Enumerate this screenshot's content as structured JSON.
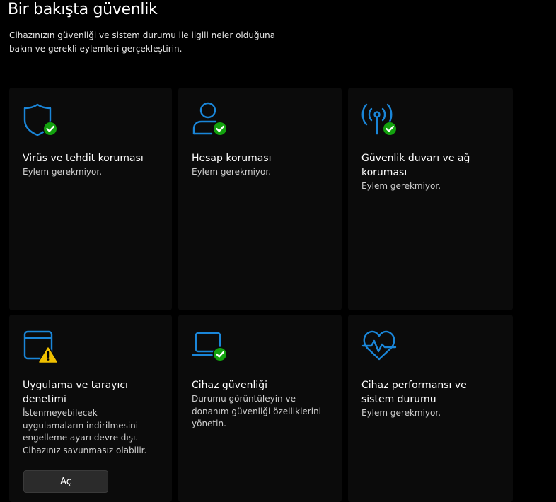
{
  "page": {
    "title": "Bir bakışta güvenlik",
    "description": "Cihazınızın güvenliği ve sistem durumu ile ilgili neler olduğuna bakın ve gerekli eylemleri gerçekleştirin."
  },
  "colors": {
    "accent": "#1a86d9",
    "ok": "#13a10e",
    "warning": "#f0c000",
    "tile_bg": "#0b0b0b",
    "page_bg": "#000000"
  },
  "tiles": [
    {
      "name": "Virüs ve tehdit koruması",
      "status": "Eylem gerekmiyor.",
      "icon": "shield-icon",
      "badge": "ok-check-icon"
    },
    {
      "name": "Hesap koruması",
      "status": "Eylem gerekmiyor.",
      "icon": "person-icon",
      "badge": "ok-check-icon"
    },
    {
      "name": "Güvenlik duvarı ve ağ koruması",
      "status": "Eylem gerekmiyor.",
      "icon": "antenna-icon",
      "badge": "ok-check-icon"
    },
    {
      "name": "Uygulama ve tarayıcı denetimi",
      "status": "İstenmeyebilecek uygulamaların indirilmesini engelleme ayarı devre dışı. Cihazınız savunmasız olabilir.",
      "icon": "browser-window-icon",
      "badge": "warning-icon",
      "button": "Aç"
    },
    {
      "name": "Cihaz güvenliği",
      "status": "Durumu görüntüleyin ve donanım güvenliği özelliklerini yönetin.",
      "icon": "laptop-icon",
      "badge": "ok-check-icon"
    },
    {
      "name": "Cihaz performansı ve sistem durumu",
      "status": "Eylem gerekmiyor.",
      "icon": "heart-pulse-icon",
      "badge": ""
    }
  ]
}
